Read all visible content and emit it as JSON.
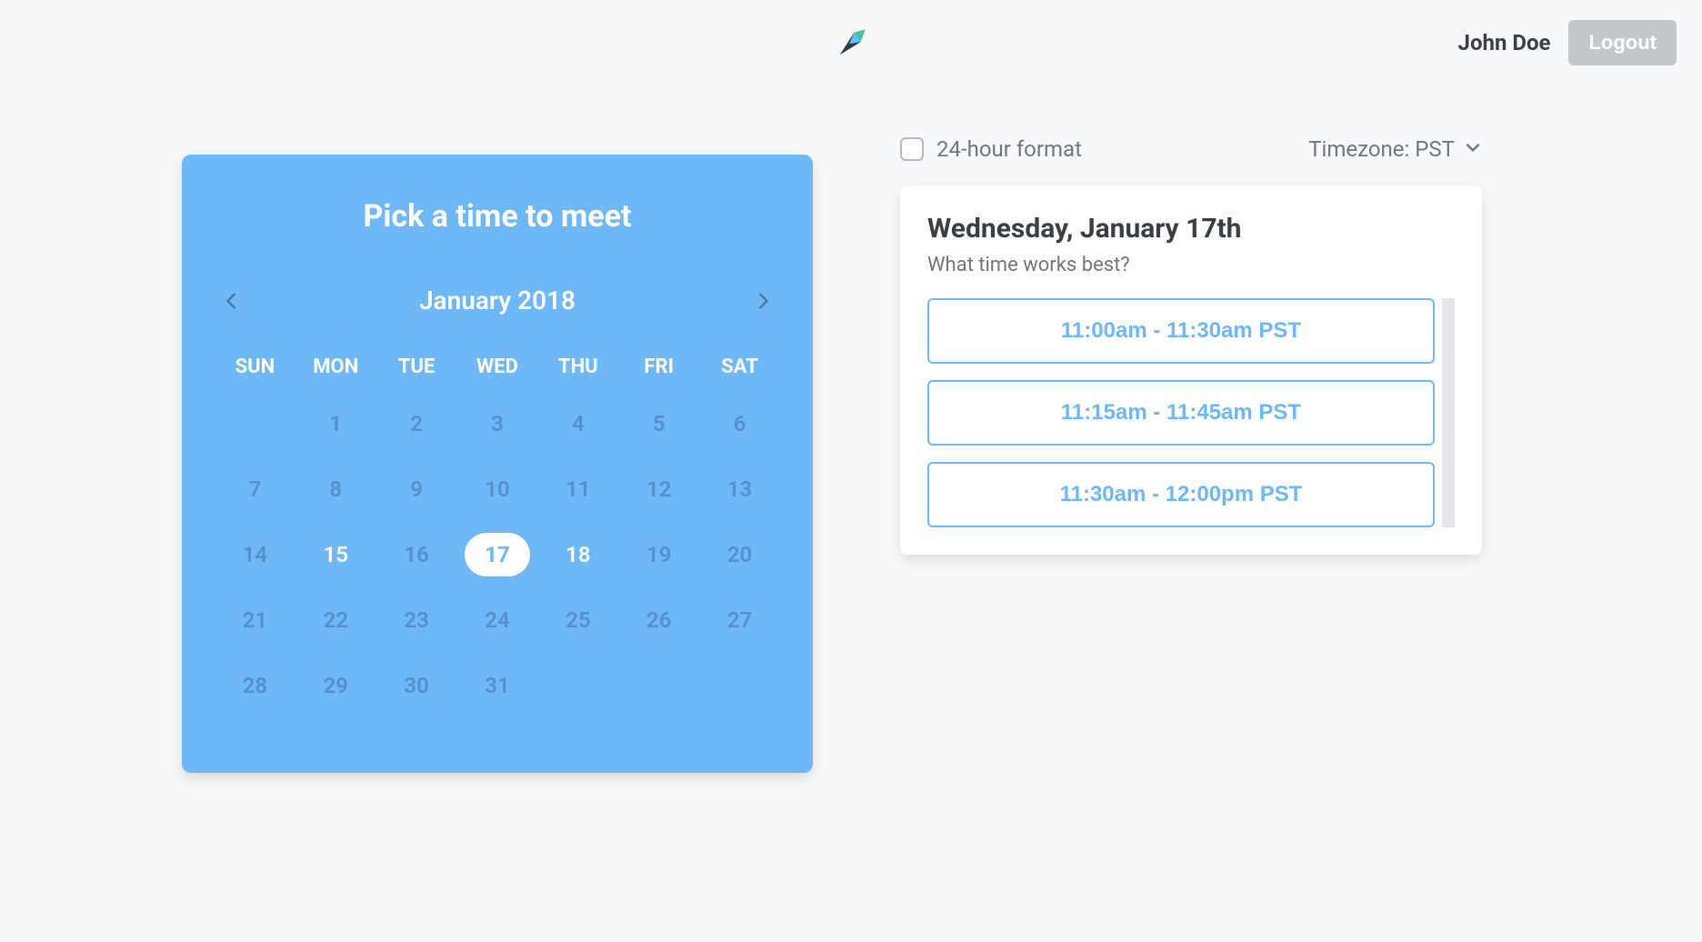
{
  "header": {
    "user_name": "John Doe",
    "logout_label": "Logout"
  },
  "calendar": {
    "title": "Pick a time to meet",
    "month_label": "January 2018",
    "weekdays": [
      "SUN",
      "MON",
      "TUE",
      "WED",
      "THU",
      "FRI",
      "SAT"
    ],
    "weeks": [
      [
        {
          "n": "",
          "state": "empty"
        },
        {
          "n": "1",
          "state": "muted"
        },
        {
          "n": "2",
          "state": "muted"
        },
        {
          "n": "3",
          "state": "muted"
        },
        {
          "n": "4",
          "state": "muted"
        },
        {
          "n": "5",
          "state": "muted"
        },
        {
          "n": "6",
          "state": "muted"
        }
      ],
      [
        {
          "n": "7",
          "state": "muted"
        },
        {
          "n": "8",
          "state": "muted"
        },
        {
          "n": "9",
          "state": "muted"
        },
        {
          "n": "10",
          "state": "muted"
        },
        {
          "n": "11",
          "state": "muted"
        },
        {
          "n": "12",
          "state": "muted"
        },
        {
          "n": "13",
          "state": "muted"
        }
      ],
      [
        {
          "n": "14",
          "state": "muted"
        },
        {
          "n": "15",
          "state": "avail"
        },
        {
          "n": "16",
          "state": "muted"
        },
        {
          "n": "17",
          "state": "selected"
        },
        {
          "n": "18",
          "state": "avail"
        },
        {
          "n": "19",
          "state": "muted"
        },
        {
          "n": "20",
          "state": "muted"
        }
      ],
      [
        {
          "n": "21",
          "state": "muted"
        },
        {
          "n": "22",
          "state": "muted"
        },
        {
          "n": "23",
          "state": "muted"
        },
        {
          "n": "24",
          "state": "muted"
        },
        {
          "n": "25",
          "state": "muted"
        },
        {
          "n": "26",
          "state": "muted"
        },
        {
          "n": "27",
          "state": "muted"
        }
      ],
      [
        {
          "n": "28",
          "state": "muted"
        },
        {
          "n": "29",
          "state": "muted"
        },
        {
          "n": "30",
          "state": "muted"
        },
        {
          "n": "31",
          "state": "muted"
        },
        {
          "n": "",
          "state": "empty"
        },
        {
          "n": "",
          "state": "empty"
        },
        {
          "n": "",
          "state": "empty"
        }
      ]
    ]
  },
  "options": {
    "format_label": "24-hour format",
    "format_checked": false,
    "timezone_label": "Timezone: PST"
  },
  "slots": {
    "date_heading": "Wednesday, January 17th",
    "subheading": "What time works best?",
    "items": [
      "11:00am - 11:30am PST",
      "11:15am - 11:45am PST",
      "11:30am - 12:00pm PST"
    ]
  },
  "colors": {
    "accent": "#6eb8f7",
    "text": "#3a3f46",
    "muted_text": "#71777f",
    "bg": "#f7f8fa"
  }
}
